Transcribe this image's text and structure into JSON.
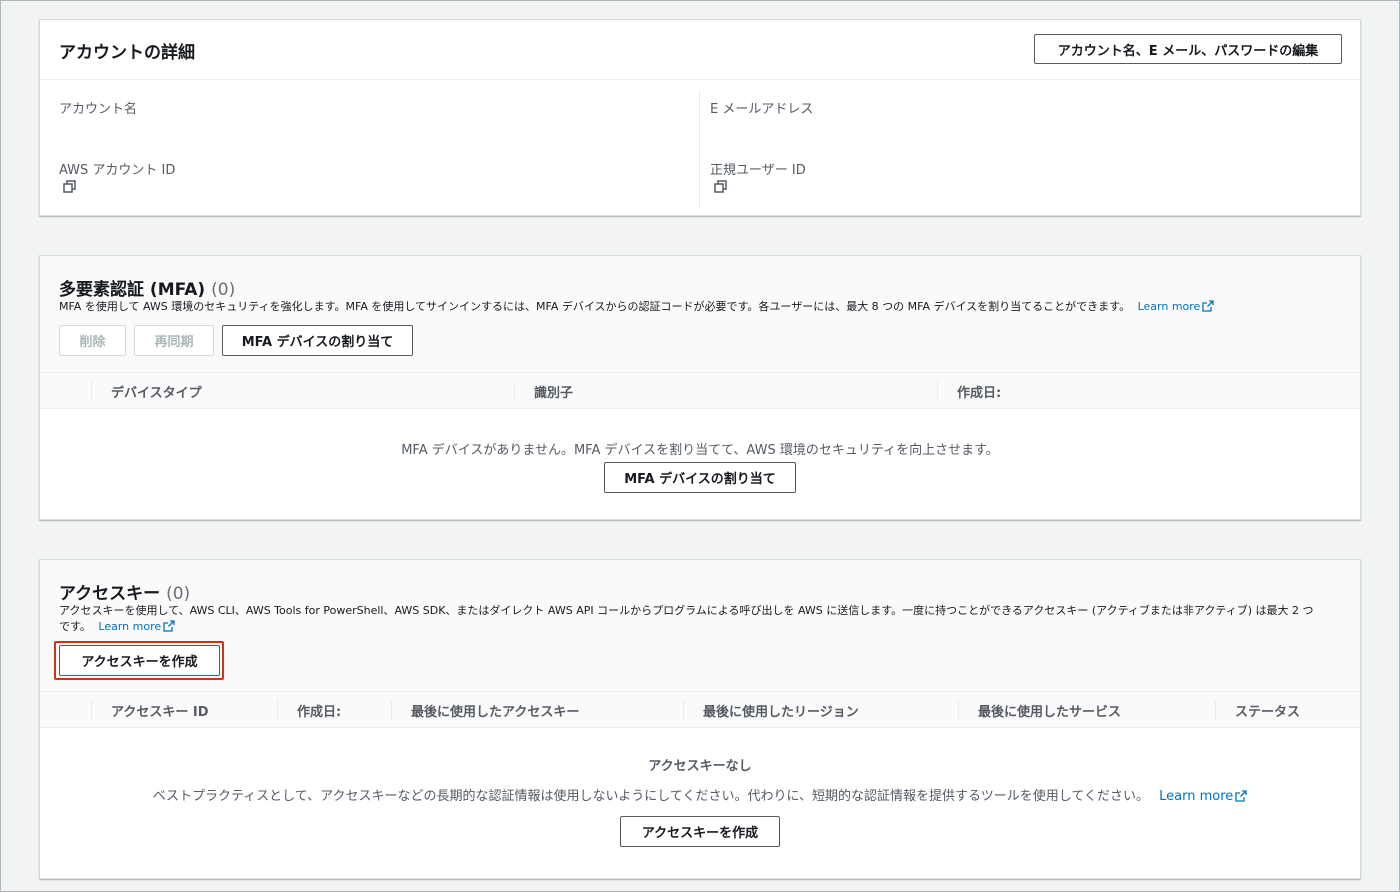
{
  "account": {
    "title": "アカウントの詳細",
    "edit_button": "アカウント名、E メール、パスワードの編集",
    "fields": {
      "account_name_label": "アカウント名",
      "email_label": "E メールアドレス",
      "aws_account_id_label": "AWS アカウント ID",
      "canonical_user_id_label": "正規ユーザー ID"
    }
  },
  "mfa": {
    "title": "多要素認証 (MFA)",
    "count": "(0)",
    "description": "MFA を使用して AWS 環境のセキュリティを強化します。MFA を使用してサインインするには、MFA デバイスからの認証コードが必要です。各ユーザーには、最大 8 つの MFA デバイスを割り当てることができます。",
    "learn_more": "Learn more",
    "buttons": {
      "delete": "削除",
      "resync": "再同期",
      "assign": "MFA デバイスの割り当て"
    },
    "columns": [
      "デバイスタイプ",
      "識別子",
      "作成日:"
    ],
    "empty_message": "MFA デバイスがありません。MFA デバイスを割り当てて、AWS 環境のセキュリティを向上させます。",
    "empty_button": "MFA デバイスの割り当て"
  },
  "access_keys": {
    "title": "アクセスキー",
    "count": "(0)",
    "description_line1": "アクセスキーを使用して、AWS CLI、AWS Tools for PowerShell、AWS SDK、またはダイレクト AWS API コールからプログラムによる呼び出しを AWS に送信します。一度に持つことができるアクセスキー (アクティブまたは非アクティブ) は最大 2 つ",
    "description_line2": "です。",
    "learn_more": "Learn more",
    "create_button": "アクセスキーを作成",
    "columns": [
      "アクセスキー ID",
      "作成日:",
      "最後に使用したアクセスキー",
      "最後に使用したリージョン",
      "最後に使用したサービス",
      "ステータス"
    ],
    "empty_title": "アクセスキーなし",
    "empty_message": "ベストプラクティスとして、アクセスキーなどの長期的な認証情報は使用しないようにしてください。代わりに、短期的な認証情報を提供するツールを使用してください。",
    "empty_learn_more": "Learn more",
    "empty_button": "アクセスキーを作成"
  },
  "colors": {
    "link": "#0073bb",
    "highlight": "#d13212",
    "background": "#f2f3f3"
  }
}
